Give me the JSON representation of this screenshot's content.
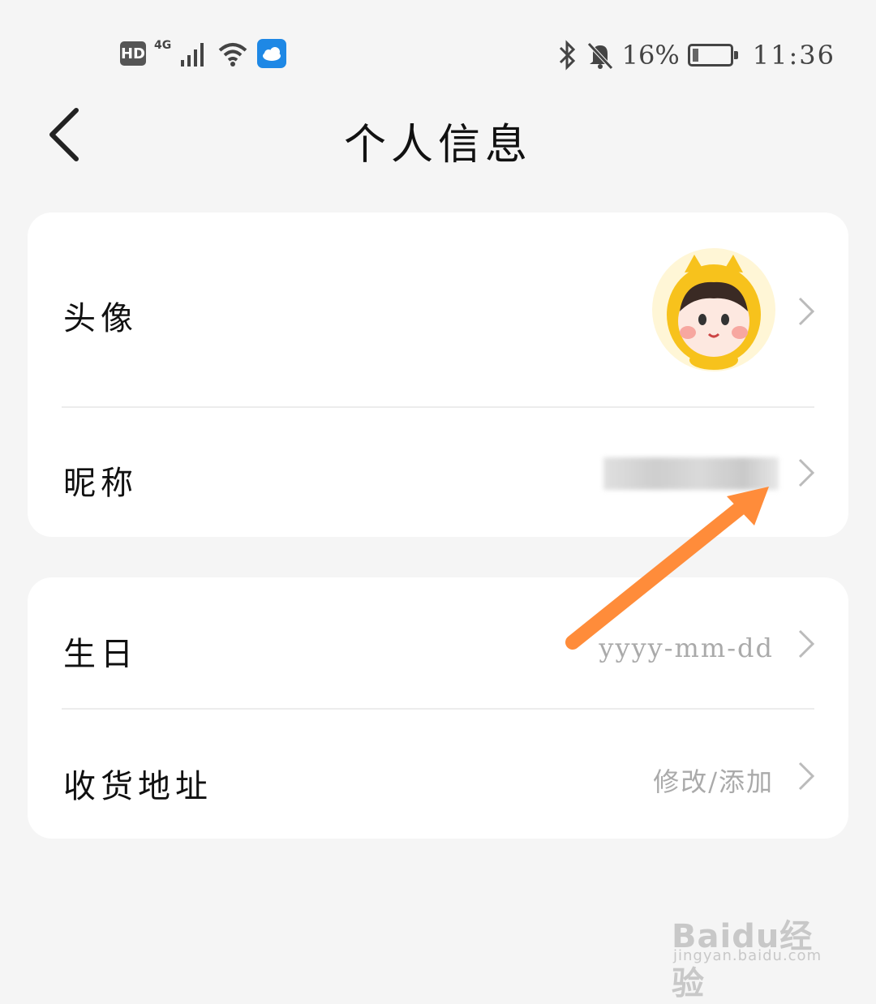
{
  "status_bar": {
    "hd": "HD",
    "network": "4G",
    "battery_percent": "16%",
    "battery_level": 0.16,
    "time": "11:36",
    "icons": [
      "signal-icon",
      "wifi-icon",
      "app-notification-icon",
      "bluetooth-icon",
      "mute-bell-icon",
      "battery-icon"
    ]
  },
  "header": {
    "title": "个人信息",
    "back_icon": "back-chevron-icon"
  },
  "profile": {
    "avatar_label": "头像",
    "nickname_label": "昵称",
    "nickname_value": ""
  },
  "details": {
    "birthday_label": "生日",
    "birthday_placeholder": "yyyy-mm-dd",
    "address_label": "收货地址",
    "address_action": "修改/添加"
  },
  "colors": {
    "background": "#f5f5f5",
    "card": "#ffffff",
    "annotation_arrow": "#ff8c3a",
    "value_text": "#aaaaaa"
  },
  "watermark": {
    "main": "Baidu经验",
    "sub": "jingyan.baidu.com"
  }
}
